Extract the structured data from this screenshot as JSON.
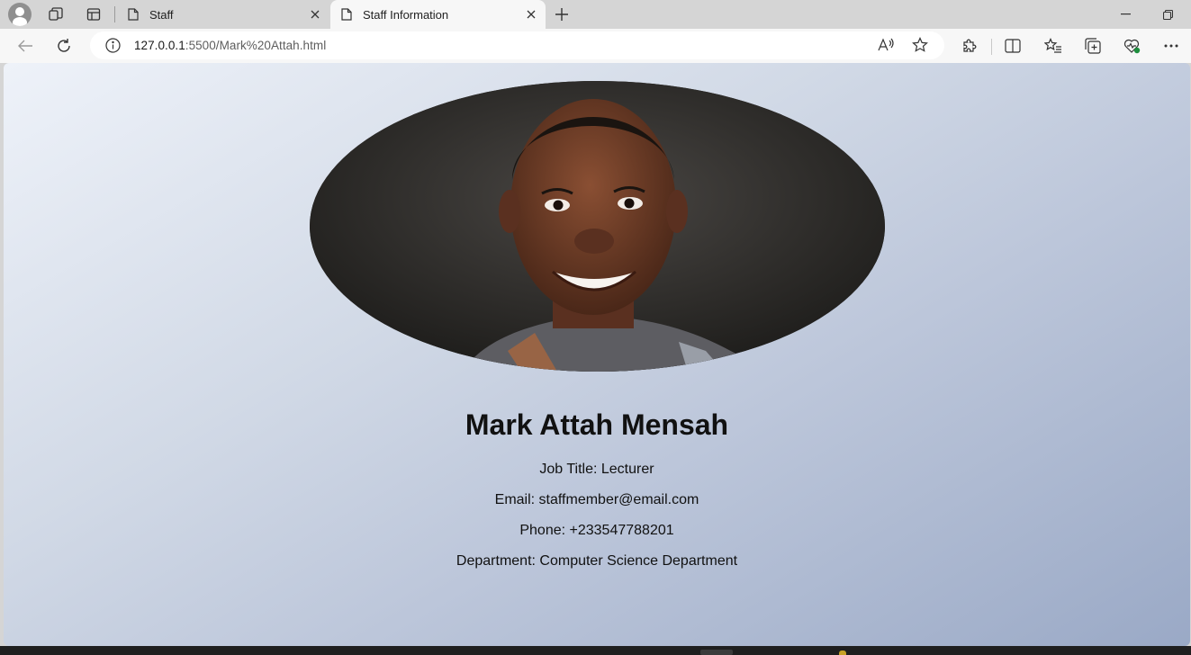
{
  "browser": {
    "tabs": [
      {
        "title": "Staff"
      },
      {
        "title": "Staff Information"
      }
    ],
    "address": {
      "host": "127.0.0.1",
      "rest": ":5500/Mark%20Attah.html"
    }
  },
  "icons": {
    "profile": "profile-icon",
    "workspaces": "workspaces-icon",
    "tab_actions": "tab-actions-icon",
    "page": "page-icon",
    "close": "close-icon",
    "new_tab": "plus-icon",
    "minimize": "minimize-icon",
    "restore": "restore-icon",
    "back": "back-arrow-icon",
    "refresh": "refresh-icon",
    "info": "info-icon",
    "read_aloud": "read-aloud-icon",
    "favorite": "star-icon",
    "extensions": "puzzle-icon",
    "split_screen": "split-screen-icon",
    "favorites": "favorites-icon",
    "collections": "collections-icon",
    "performance": "performance-icon",
    "more": "more-icon"
  },
  "staff": {
    "name": "Mark Attah Mensah",
    "job_title": "Job Title: Lecturer",
    "email": "Email: staffmember@email.com",
    "phone": "Phone: +233547788201",
    "department": "Department: Computer Science Department"
  },
  "colors": {
    "page_gradient": [
      "#eef2f9",
      "#d1d9e6",
      "#bcc6da",
      "#9aa9c6"
    ],
    "tabstrip": "#d5d5d5",
    "active_tab": "#f7f7f7",
    "text": "#111111"
  }
}
